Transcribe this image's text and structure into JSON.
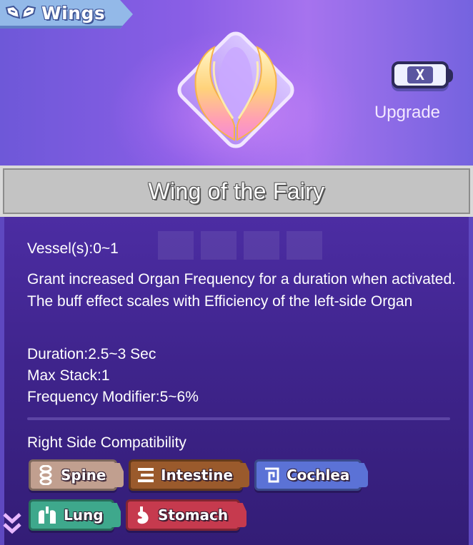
{
  "header": {
    "category_icon": "wings-icon",
    "category_label": "Wings",
    "item_art_icon": "fairy-wing-icon",
    "close_icon": "close-icon",
    "close_label": "X",
    "upgrade_label": "Upgrade"
  },
  "item": {
    "title": "Wing of the Fairy",
    "vessels": "Vessel(s):0~1",
    "description": "Grant increased Organ Frequency for a duration when activated. The buff effect scales with Efficiency of the left-side Organ",
    "stats": {
      "duration": "Duration:2.5~3 Sec",
      "max_stack": "Max Stack:1",
      "frequency_modifier": "Frequency Modifier:5~6%"
    }
  },
  "compatibility": {
    "heading": "Right Side Compatibility",
    "tags": [
      {
        "label": "Spine",
        "icon": "spine-icon",
        "color": "#c19f8f"
      },
      {
        "label": "Intestine",
        "icon": "intestine-icon",
        "color": "#9a5a2c"
      },
      {
        "label": "Cochlea",
        "icon": "cochlea-icon",
        "color": "#5b72d6"
      },
      {
        "label": "Lung",
        "icon": "lung-icon",
        "color": "#3ea88c"
      },
      {
        "label": "Stomach",
        "icon": "stomach-icon",
        "color": "#c63a4e"
      }
    ]
  },
  "scroll": {
    "icon": "double-chevron-down-icon"
  },
  "colors": {
    "header_bg": "#8a5ee6",
    "panel_bg": "#3f248c",
    "title_bar_bg": "#c3c3c3",
    "upgrade_text": "#f3e8ff"
  }
}
